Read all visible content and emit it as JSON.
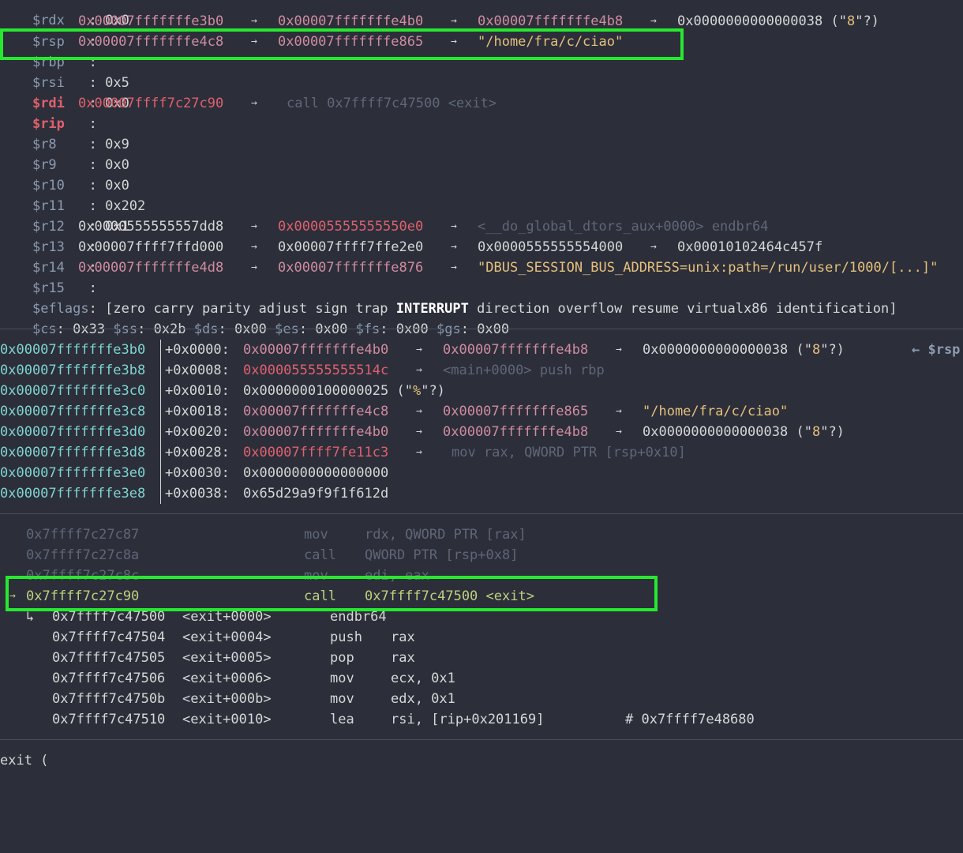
{
  "colors": {
    "background": "#2c2f3a",
    "register_name": "#8c9bb0",
    "register_changed": "#e0606d",
    "stack_pointer_value": "#d08ba0",
    "code_pointer_value": "#e0606d",
    "string_value": "#e6c07b",
    "dim_text": "#5f6677",
    "stack_address": "#7fd3d0",
    "current_instruction": "#bcd27c",
    "highlight_box": "#27e82f"
  },
  "registers": {
    "rdx": {
      "name": "$rdx",
      "colon": "   : ",
      "value": "0x0"
    },
    "rsp": {
      "name": "$rsp",
      "colon": "   : ",
      "v1": "0x00007fffffffe3b0",
      "v2": "0x00007fffffffe4b0",
      "v3": "0x00007fffffffe4b8",
      "v4": "0x0000000000000038",
      "v4_suffix_a": " (\"",
      "v4_char": "8",
      "v4_suffix_b": "\"?)"
    },
    "rbp": {
      "name": "$rbp",
      "colon": "   : ",
      "v1": "0x00007fffffffe4c8",
      "v2": "0x00007fffffffe865",
      "v3": "\"/home/fra/c/ciao\""
    },
    "rsi": {
      "name": "$rsi",
      "colon": "   : ",
      "value": "0x5"
    },
    "rdi": {
      "name": "$rdi",
      "colon": "   : ",
      "value": "0x0"
    },
    "rip": {
      "name": "$rip",
      "colon": "   : ",
      "v1": "0x00007ffff7c27c90",
      "v2": "call 0x7ffff7c47500 <exit>"
    },
    "r8": {
      "name": "$r8",
      "colon": "    : ",
      "value": "0x9"
    },
    "r9": {
      "name": "$r9",
      "colon": "    : ",
      "value": "0x0"
    },
    "r10": {
      "name": "$r10",
      "colon": "   : ",
      "value": "0x0"
    },
    "r11": {
      "name": "$r11",
      "colon": "   : ",
      "value": "0x202"
    },
    "r12": {
      "name": "$r12",
      "colon": "   : ",
      "value": "0x1"
    },
    "r13": {
      "name": "$r13",
      "colon": "   : ",
      "v1": "0x0000555555557dd8",
      "v2": "0x00005555555550e0",
      "v3": "<__do_global_dtors_aux+0000> endbr64"
    },
    "r14": {
      "name": "$r14",
      "colon": "   : ",
      "v1": "0x00007ffff7ffd000",
      "v2": "0x00007ffff7ffe2e0",
      "v3": "0x0000555555554000",
      "v4": "0x00010102464c457f"
    },
    "r15": {
      "name": "$r15",
      "colon": "   : ",
      "v1": "0x00007fffffffe4d8",
      "v2": "0x00007fffffffe876",
      "v3": "\"DBUS_SESSION_BUS_ADDRESS=unix:path=/run/user/1000/[...]\""
    },
    "eflags": {
      "name": "$eflags",
      "colon": ": ",
      "open": "[",
      "close": "]",
      "flags": [
        "zero",
        "carry",
        "parity",
        "adjust",
        "sign",
        "trap",
        "INTERRUPT",
        "direction",
        "overflow",
        "resume",
        "virtualx86",
        "identification"
      ]
    },
    "segments": [
      {
        "name": "$cs",
        "value": "0x33"
      },
      {
        "name": "$ss",
        "value": "0x2b"
      },
      {
        "name": "$ds",
        "value": "0x00"
      },
      {
        "name": "$es",
        "value": "0x00"
      },
      {
        "name": "$fs",
        "value": "0x00"
      },
      {
        "name": "$gs",
        "value": "0x00"
      }
    ]
  },
  "arrow": "→",
  "stack": {
    "rsp_marker": "← $rsp",
    "rows": [
      {
        "addr": "0x00007fffffffe3b0",
        "off": "+0x0000: ",
        "v1": "0x00007fffffffe4b0",
        "v2": "0x00007fffffffe4b8",
        "v3": "0x0000000000000038",
        "v3_a": " (\"",
        "v3_char": "8",
        "v3_b": "\"?)"
      },
      {
        "addr": "0x00007fffffffe3b8",
        "off": "+0x0008: ",
        "v1": "0x000055555555514c",
        "v2": "<main+0000> push rbp"
      },
      {
        "addr": "0x00007fffffffe3c0",
        "off": "+0x0010: ",
        "v1": "0x0000000100000025",
        "v1_a": " (\"",
        "v1_char": "%",
        "v1_b": "\"?)"
      },
      {
        "addr": "0x00007fffffffe3c8",
        "off": "+0x0018: ",
        "v1": "0x00007fffffffe4c8",
        "v2": "0x00007fffffffe865",
        "v3": "\"/home/fra/c/ciao\""
      },
      {
        "addr": "0x00007fffffffe3d0",
        "off": "+0x0020: ",
        "v1": "0x00007fffffffe4b0",
        "v2": "0x00007fffffffe4b8",
        "v3": "0x0000000000000038",
        "v3_a": " (\"",
        "v3_char": "8",
        "v3_b": "\"?)"
      },
      {
        "addr": "0x00007fffffffe3d8",
        "off": "+0x0028: ",
        "v1": "0x00007ffff7fe11c3",
        "v2": "mov rax, QWORD PTR [rsp+0x10]"
      },
      {
        "addr": "0x00007fffffffe3e0",
        "off": "+0x0030: ",
        "v1": "0x0000000000000000"
      },
      {
        "addr": "0x00007fffffffe3e8",
        "off": "+0x0038: ",
        "v1": "0x65d29a9f9f1f612d"
      }
    ]
  },
  "code": {
    "cur_marker": "→",
    "branch_marker": "↳",
    "before": [
      {
        "addr": "0x7ffff7c27c87",
        "mnem": "mov",
        "ops": "rdx, QWORD PTR [rax]"
      },
      {
        "addr": "0x7ffff7c27c8a",
        "mnem": "call",
        "ops": "QWORD PTR [rsp+0x8]"
      },
      {
        "addr": "0x7ffff7c27c8c",
        "mnem": "mov",
        "ops": "edi, eax"
      }
    ],
    "current": {
      "addr": "0x7ffff7c27c90",
      "mnem": "call",
      "ops": "0x7ffff7c47500 <exit>"
    },
    "after": [
      {
        "addr": "0x7ffff7c47500",
        "sym": "<exit+0000>",
        "mnem": "endbr64",
        "ops": ""
      },
      {
        "addr": "0x7ffff7c47504",
        "sym": "<exit+0004>",
        "mnem": "push",
        "ops": "rax"
      },
      {
        "addr": "0x7ffff7c47505",
        "sym": "<exit+0005>",
        "mnem": "pop",
        "ops": "rax"
      },
      {
        "addr": "0x7ffff7c47506",
        "sym": "<exit+0006>",
        "mnem": "mov",
        "ops": "ecx, 0x1"
      },
      {
        "addr": "0x7ffff7c4750b",
        "sym": "<exit+000b>",
        "mnem": "mov",
        "ops": "edx, 0x1"
      },
      {
        "addr": "0x7ffff7c47510",
        "sym": "<exit+0010>",
        "mnem": "lea",
        "ops": "rsi, [rip+0x201169]",
        "comment": "# 0x7ffff7e48680"
      }
    ]
  },
  "args": {
    "text": "exit ("
  }
}
